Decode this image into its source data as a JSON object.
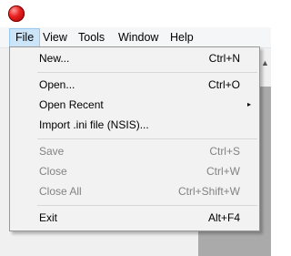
{
  "menubar": {
    "items": [
      "File",
      "View",
      "Tools",
      "Window",
      "Help"
    ]
  },
  "file_menu": {
    "items": [
      {
        "label": "New...",
        "shortcut": "Ctrl+N"
      },
      {
        "label": "Open...",
        "shortcut": "Ctrl+O"
      },
      {
        "label": "Open Recent",
        "shortcut": ""
      },
      {
        "label": "Import .ini file (NSIS)...",
        "shortcut": ""
      },
      {
        "label": "Save",
        "shortcut": "Ctrl+S"
      },
      {
        "label": "Close",
        "shortcut": "Ctrl+W"
      },
      {
        "label": "Close All",
        "shortcut": "Ctrl+Shift+W"
      },
      {
        "label": "Exit",
        "shortcut": "Alt+F4"
      }
    ],
    "submenu_arrow": "▸"
  },
  "colors": {
    "menu_highlight": "#cce4f7",
    "disabled_text": "#838383",
    "app_icon": "#e82020"
  }
}
